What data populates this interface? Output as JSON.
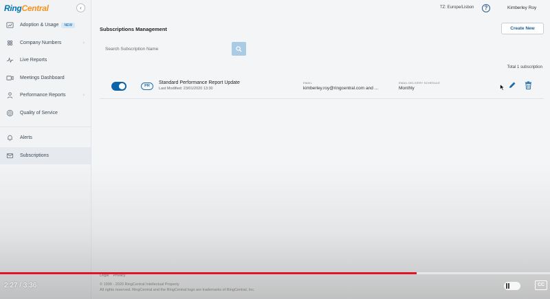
{
  "app": {
    "logo_part1": "Ring",
    "logo_part2": "Central",
    "collapse_glyph": "‹"
  },
  "sidebar": {
    "items": [
      {
        "label": "Adoption & Usage",
        "badge": "NEW",
        "icon": "chart-icon"
      },
      {
        "label": "Company Numbers",
        "icon": "numbers-icon"
      },
      {
        "label": "Live Reports",
        "icon": "pulse-icon"
      },
      {
        "label": "Meetings Dashboard",
        "icon": "video-icon"
      },
      {
        "label": "Performance Reports",
        "icon": "person-icon"
      },
      {
        "label": "Quality of Service",
        "icon": "gauge-icon"
      },
      {
        "label": "Alerts",
        "icon": "bell-icon"
      },
      {
        "label": "Subscriptions",
        "icon": "envelope-icon",
        "active": true
      }
    ]
  },
  "header": {
    "timezone": "TZ: Europe/Lisbon",
    "help": "?",
    "user": "Kimberley Roy"
  },
  "main": {
    "title": "Subscriptions Management",
    "create_label": "Create New",
    "search_placeholder": "Search Subscription Name",
    "total": "Total 1 subscription"
  },
  "subscription": {
    "enabled": true,
    "type_badge": "PR",
    "name": "Standard Performance Report Update",
    "modified": "Last Modified: 23/01/2020 13:30",
    "email_label": "EMAIL",
    "email_value": "kimberley.roy@ringcentral.com and ...",
    "schedule_label": "EMAIL DELIVERY SCHEDULE",
    "schedule_value": "Monthly"
  },
  "footer": {
    "legal": "Legal",
    "privacy": "Privacy",
    "copyright": "© 1999 - 2020 RingCentral Intellectual Property",
    "trademark": "All rights reserved. RingCentral and the RingCentral logo are trademarks of RingCentral, Inc."
  },
  "video": {
    "time": "2:27 / 3:36",
    "progress": 0.757,
    "cc_label": "CC",
    "accent": "#e1122a"
  }
}
